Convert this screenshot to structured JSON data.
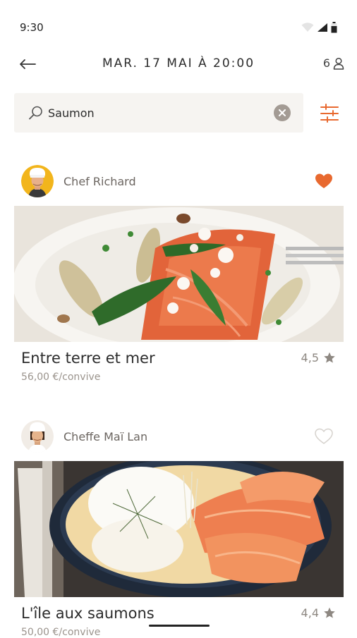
{
  "status_bar": {
    "time": "9:30",
    "icons": [
      "wifi-icon",
      "signal-icon",
      "battery-icon"
    ]
  },
  "header": {
    "title": "MAR. 17 MAI À 20:00",
    "guests_count": "6",
    "icons": {
      "back": "back-arrow-icon",
      "guests": "person-icon"
    }
  },
  "search": {
    "value": "Saumon",
    "placeholder": "",
    "icons": {
      "search": "search-icon",
      "clear": "clear-icon",
      "filter": "filter-sliders-icon"
    }
  },
  "results": [
    {
      "chef_name": "Chef Richard",
      "dish_title": "Entre terre et mer",
      "price": "56,00 €/convive",
      "rating": "4,5",
      "favorite": true,
      "image": "salmon-asparagus-dish-photo"
    },
    {
      "chef_name": "Cheffe Maï Lan",
      "dish_title": "L'île aux saumons",
      "price": "50,00 €/convive",
      "rating": "4,4",
      "favorite": false,
      "image": "smoked-salmon-bowl-photo"
    }
  ],
  "colors": {
    "accent": "#e8692f",
    "search_bg": "#f6f4f1",
    "muted_text": "#9b948d",
    "star": "#8e8882"
  }
}
